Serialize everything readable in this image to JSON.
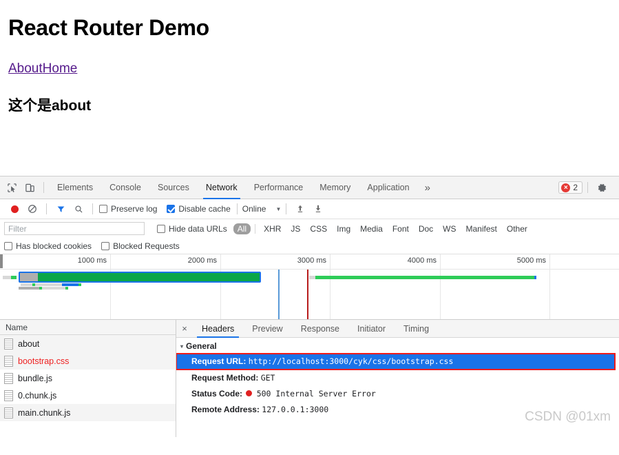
{
  "page": {
    "title": "React Router Demo",
    "links": [
      {
        "label": "About"
      },
      {
        "label": "Home"
      }
    ],
    "body_text": "这个是about"
  },
  "devtools": {
    "left_icons": [
      {
        "name": "inspect-element-icon"
      },
      {
        "name": "device-toolbar-icon"
      }
    ],
    "tabs": [
      {
        "label": "Elements",
        "active": false
      },
      {
        "label": "Console",
        "active": false
      },
      {
        "label": "Sources",
        "active": false
      },
      {
        "label": "Network",
        "active": true
      },
      {
        "label": "Performance",
        "active": false
      },
      {
        "label": "Memory",
        "active": false
      },
      {
        "label": "Application",
        "active": false
      }
    ],
    "more_tabs_glyph": "»",
    "error_badge": {
      "glyph": "×",
      "count": "2"
    },
    "settings_icon": "gear-icon",
    "controls": {
      "record_label": "record-button",
      "clear_label": "clear-button",
      "filter_label": "filter-button",
      "search_label": "search-button",
      "preserve_log": {
        "label": "Preserve log",
        "checked": false
      },
      "disable_cache": {
        "label": "Disable cache",
        "checked": true
      },
      "throttle": {
        "value": "Online",
        "caret": "▼"
      },
      "import_label": "import-har-button",
      "export_label": "export-har-button"
    },
    "filter": {
      "placeholder": "Filter",
      "value": "",
      "hide_data_urls": {
        "label": "Hide data URLs",
        "checked": false
      },
      "types": [
        {
          "label": "All",
          "selected": true
        },
        {
          "label": "XHR",
          "selected": false
        },
        {
          "label": "JS",
          "selected": false
        },
        {
          "label": "CSS",
          "selected": false
        },
        {
          "label": "Img",
          "selected": false
        },
        {
          "label": "Media",
          "selected": false
        },
        {
          "label": "Font",
          "selected": false
        },
        {
          "label": "Doc",
          "selected": false
        },
        {
          "label": "WS",
          "selected": false
        },
        {
          "label": "Manifest",
          "selected": false
        },
        {
          "label": "Other",
          "selected": false
        }
      ],
      "has_blocked_cookies": {
        "label": "Has blocked cookies",
        "checked": false
      },
      "blocked_requests": {
        "label": "Blocked Requests",
        "checked": false
      }
    },
    "overview": {
      "ticks": [
        "1000 ms",
        "2000 ms",
        "3000 ms",
        "4000 ms",
        "5000 ms"
      ]
    },
    "request_list": {
      "column_header": "Name",
      "rows": [
        {
          "name": "about",
          "error": false
        },
        {
          "name": "bootstrap.css",
          "error": true
        },
        {
          "name": "bundle.js",
          "error": false
        },
        {
          "name": "0.chunk.js",
          "error": false
        },
        {
          "name": "main.chunk.js",
          "error": false
        }
      ]
    },
    "detail": {
      "close_glyph": "×",
      "tabs": [
        {
          "label": "Headers",
          "active": true
        },
        {
          "label": "Preview",
          "active": false
        },
        {
          "label": "Response",
          "active": false
        },
        {
          "label": "Initiator",
          "active": false
        },
        {
          "label": "Timing",
          "active": false
        }
      ],
      "general": {
        "caret": "▾",
        "section_title": "General",
        "request_url_key": "Request URL:",
        "request_url_value": "http://localhost:3000/cyk/css/bootstrap.css",
        "request_method_key": "Request Method:",
        "request_method_value": "GET",
        "status_code_key": "Status Code:",
        "status_code_value": "500 Internal Server Error",
        "remote_address_key": "Remote Address:",
        "remote_address_value": "127.0.0.1:3000"
      }
    },
    "watermark": "CSDN @01xm"
  },
  "colors": {
    "accent": "#1a73e8",
    "error": "#e53935",
    "link": "#551a8b",
    "highlight_outline": "#ee1c1c",
    "waterfall_green": "#0aa648"
  }
}
